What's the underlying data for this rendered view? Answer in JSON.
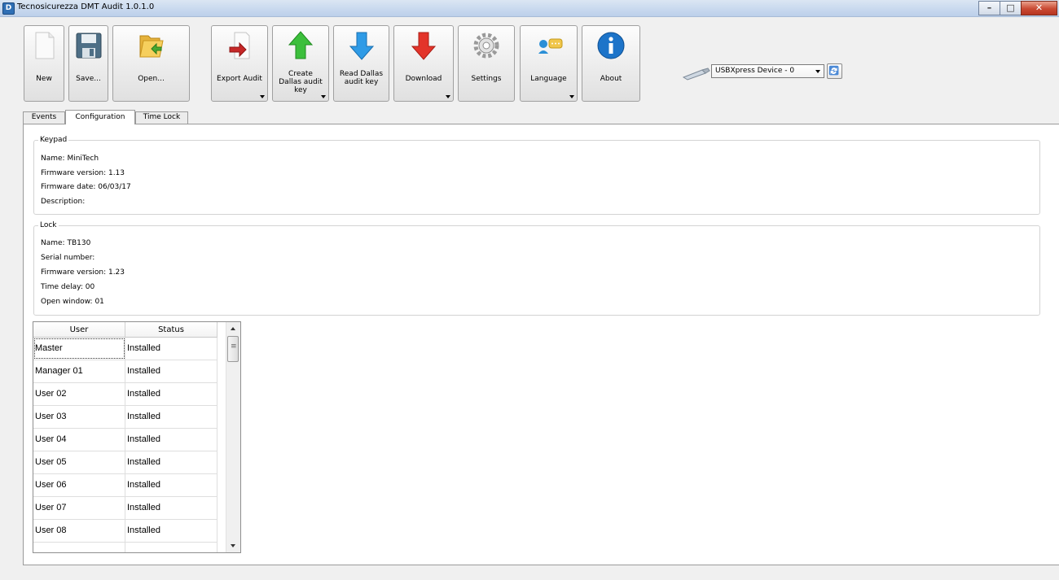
{
  "window": {
    "title": "Tecnosicurezza DMT Audit 1.0.1.0",
    "app_icon_glyph": "D",
    "controls": {
      "minimize": "–",
      "maximize": "□",
      "close": "✕"
    }
  },
  "toolbar": {
    "buttons": [
      {
        "id": "new",
        "label": "New",
        "icon": "new-document-icon"
      },
      {
        "id": "save",
        "label": "Save...",
        "icon": "floppy-disk-icon"
      },
      {
        "id": "open",
        "label": "Open...",
        "icon": "folder-open-icon"
      },
      {
        "id": "export",
        "label": "Export Audit",
        "icon": "export-icon",
        "has_menu": true
      },
      {
        "id": "create-dallas",
        "label": "Create Dallas audit key",
        "icon": "green-up-arrow-icon",
        "has_menu": true
      },
      {
        "id": "read-dallas",
        "label": "Read Dallas audit key",
        "icon": "blue-down-arrow-icon"
      },
      {
        "id": "download",
        "label": "Download",
        "icon": "red-down-arrow-icon",
        "has_menu": true
      },
      {
        "id": "settings",
        "label": "Settings",
        "icon": "gear-icon"
      },
      {
        "id": "language",
        "label": "Language",
        "icon": "speech-bubble-icon",
        "has_menu": true
      },
      {
        "id": "about",
        "label": "About",
        "icon": "info-icon"
      }
    ],
    "device": {
      "icon": "usb-stick-icon",
      "selected": "USBXpress Device - 0",
      "refresh_icon": "refresh-icon"
    }
  },
  "tabs": [
    {
      "label": "Events",
      "active": false
    },
    {
      "label": "Configuration",
      "active": true
    },
    {
      "label": "Time Lock",
      "active": false
    }
  ],
  "keypad": {
    "title": "Keypad",
    "name": "Name:  MiniTech",
    "firmware_version": "Firmware version:  1.13",
    "firmware_date": "Firmware date:  06/03/17",
    "description": "Description:"
  },
  "lock": {
    "title": "Lock",
    "name": "Name:  TB130",
    "serial_number": "Serial number:",
    "firmware_version": "Firmware version:  1.23",
    "time_delay": "Time delay:  00",
    "open_window": "Open window:  01"
  },
  "users_grid": {
    "columns": [
      "User",
      "Status"
    ],
    "rows": [
      [
        "Master",
        "Installed"
      ],
      [
        "Manager 01",
        "Installed"
      ],
      [
        "User 02",
        "Installed"
      ],
      [
        "User 03",
        "Installed"
      ],
      [
        "User 04",
        "Installed"
      ],
      [
        "User 05",
        "Installed"
      ],
      [
        "User 06",
        "Installed"
      ],
      [
        "User 07",
        "Installed"
      ],
      [
        "User 08",
        "Installed"
      ],
      [
        "",
        ""
      ]
    ]
  }
}
